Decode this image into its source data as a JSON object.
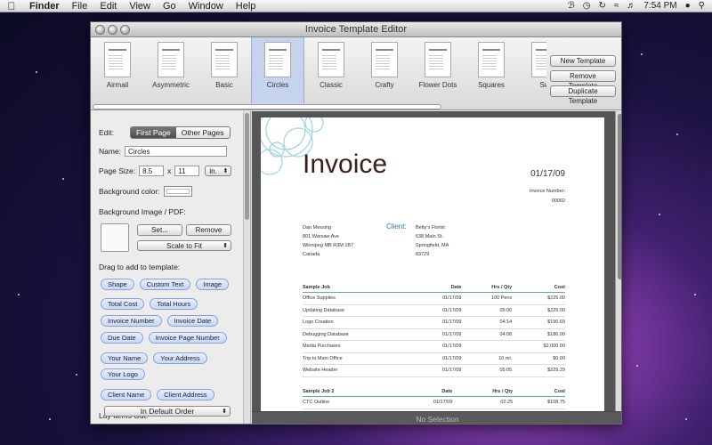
{
  "menubar": {
    "apple_icon": "apple-logo",
    "app_name": "Finder",
    "items": [
      "File",
      "Edit",
      "View",
      "Go",
      "Window",
      "Help"
    ],
    "clock": "7:54 PM"
  },
  "window": {
    "title": "Invoice Template Editor"
  },
  "templates": [
    {
      "name": "Airmail"
    },
    {
      "name": "Asymmetric"
    },
    {
      "name": "Basic"
    },
    {
      "name": "Circles",
      "selected": true
    },
    {
      "name": "Classic"
    },
    {
      "name": "Crafty"
    },
    {
      "name": "Flower Dots"
    },
    {
      "name": "Squares"
    },
    {
      "name": "Sw"
    }
  ],
  "template_buttons": {
    "new": "New Template",
    "remove": "Remove Template",
    "duplicate": "Duplicate Template"
  },
  "panel": {
    "edit_label": "Edit:",
    "edit_tabs": [
      "First Page",
      "Other Pages"
    ],
    "name_label": "Name:",
    "name_value": "Circles",
    "page_size_label": "Page Size:",
    "page_width": "8.5",
    "page_x": "x",
    "page_height": "11",
    "page_unit": "in.",
    "bg_color_label": "Background color:",
    "bg_image_label": "Background Image / PDF:",
    "set_button": "Set...",
    "remove_button": "Remove",
    "scale_option": "Scale to Fit",
    "drag_label": "Drag to add to template:",
    "tokens": [
      [
        "Shape",
        "Custom Text",
        "Image"
      ],
      [
        "Total Cost",
        "Total Hours"
      ],
      [
        "Invoice Number",
        "Invoice Date"
      ],
      [
        "Due Date",
        "Invoice Page Number"
      ],
      [
        "Your Name",
        "Your Address"
      ],
      [
        "Your Logo"
      ],
      [
        "Client Name",
        "Client Address"
      ]
    ],
    "layout_label": "Lay Items Out:",
    "layout_option": "In Default Order"
  },
  "invoice": {
    "title": "Invoice",
    "date": "01/17/09",
    "number_label": "Invoice Number:",
    "number": "00002",
    "sender": [
      "Dan Messing",
      "801 Warsaw Ave",
      "Winnipeg MB R3M 1B7",
      "Canada"
    ],
    "client_label": "Client:",
    "client": [
      "Betty's Florist",
      "638 Main St.",
      "Springfield, MA",
      "83729"
    ],
    "columns": [
      "Date",
      "Hrs / Qty",
      "Cost"
    ],
    "job1_title": "Sample Job",
    "job1_rows": [
      [
        "Office Supplies",
        "01/17/09",
        "100 Pens",
        "$225.00"
      ],
      [
        "Updating Database",
        "01/17/09",
        "05:00",
        "$225.00"
      ],
      [
        "Logo Creation",
        "01/17/09",
        "04:14",
        "$190.69"
      ],
      [
        "Debugging Database",
        "01/17/09",
        "04:08",
        "$186.00"
      ],
      [
        "Media Purchases",
        "01/17/09",
        "",
        "$2,000.00"
      ],
      [
        "Trip to Main Office",
        "01/17/09",
        "10 mi.",
        "$0.00"
      ],
      [
        "Website Header",
        "01/17/09",
        "05:05",
        "$229.29"
      ]
    ],
    "job2_title": "Sample Job 2",
    "job2_rows": [
      [
        "CTC Outline",
        "01/17/09",
        "02:25",
        "$108.75"
      ]
    ]
  },
  "status": "No Selection"
}
